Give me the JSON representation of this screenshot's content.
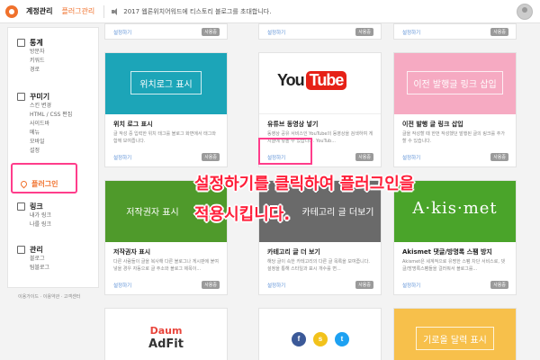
{
  "topbar": {
    "account_manage": "계정관리",
    "plugin_manage": "플러그관리",
    "notice": "2017 웹론위치어워드에 티스토리 블로그를 초대합니다.",
    "icons": [
      "tistory-logo-icon",
      "speaker-icon",
      "avatar"
    ]
  },
  "sidebar": {
    "stats": {
      "title": "통계",
      "items": [
        "방문자",
        "키워드",
        "경로"
      ]
    },
    "decorate": {
      "title": "꾸미기",
      "items": [
        "스킨 변경",
        "HTML / CSS 편집",
        "사이드바",
        "메뉴",
        "모바일",
        "설정"
      ]
    },
    "plugin": {
      "title": "플러그인"
    },
    "link": {
      "title": "링크",
      "items": [
        "내가 링크",
        "나를 링크"
      ]
    },
    "manage": {
      "title": "관리",
      "items": [
        "블로그",
        "팀블로그"
      ]
    },
    "footer": "이용가이드 · 이용약관 · 고객센터"
  },
  "top_row": [
    {
      "link": "설정하기",
      "status": "사용중"
    },
    {
      "link": "설정하기",
      "status": "사용중"
    },
    {
      "link": "설정하기",
      "status": "사용중"
    }
  ],
  "cards": [
    {
      "image_text": "위치로그 표시",
      "title": "위치 로그 표시",
      "desc": "글 작성 중 입력한 위치 태그를 블로그 화면에서 태그와 함께 보여줍니다.",
      "link": "설정하기",
      "status": "사용중"
    },
    {
      "image_text_you": "You",
      "image_text_tube": "Tube",
      "title": "유튜브 동영상 넣기",
      "desc": "동영상 공유 서비스인 YouTube의 동영상을 검색하여 게시글에 넣을 수 있습니다. YouTub...",
      "link": "설정하기",
      "status": "사용중"
    },
    {
      "image_text": "이전 발행글 링크 삽입",
      "title": "이전 발행 글 링크 삽입",
      "desc": "글을 작성할 때 한번 작성했던 발행된 글의 링크를 추가할 수 있습니다.",
      "link": "설정하기",
      "status": "사용중"
    },
    {
      "image_text": "저작권자 표시",
      "title": "저작권자 표시",
      "desc": "다른 사람들이 글을 복사해 다른 블로그나 게시판에 붙여넣을 경우 자동으로 글 주소와 블로그 제목이...",
      "link": "설정하기",
      "status": "사용중"
    },
    {
      "image_text": "카테고리 글 더보기",
      "title": "카테고리 글 더 보기",
      "desc": "해당 글이 속한 카테고리의 다른 글 목록을 보여줍니다. 설정을 통해 스타일과 표시 개수를 변...",
      "link": "설정하기",
      "status": "사용중"
    },
    {
      "image_text": "A·kis·met",
      "title": "Akismet 댓글/방명록 스팸 방지",
      "desc": "Akismet은 세계적으로 유명한 스팸 차단 서비스로, 댓글/방명록스팸들을 걸러줘서 블로그를...",
      "link": "설정하기",
      "status": "사용중"
    },
    {
      "image_text_daum": "Daum",
      "image_text_adfit": "AdFit"
    },
    {
      "icons": [
        "facebook-icon",
        "kakaostory-icon",
        "twitter-icon"
      ]
    },
    {
      "image_text": "기로올 달력 표시"
    }
  ],
  "overlay": {
    "line1": "설정하기를 클릭하여 플러그인을",
    "line2": "적용시킵니다."
  },
  "colors": {
    "accent": "#f0712c",
    "highlight": "#ff3d8b",
    "overlay_text": "#ff1f3a",
    "teal": "#1ca5b8",
    "pink": "#f6aac2",
    "green": "#4f9a2b",
    "youtube_red": "#e62117"
  }
}
